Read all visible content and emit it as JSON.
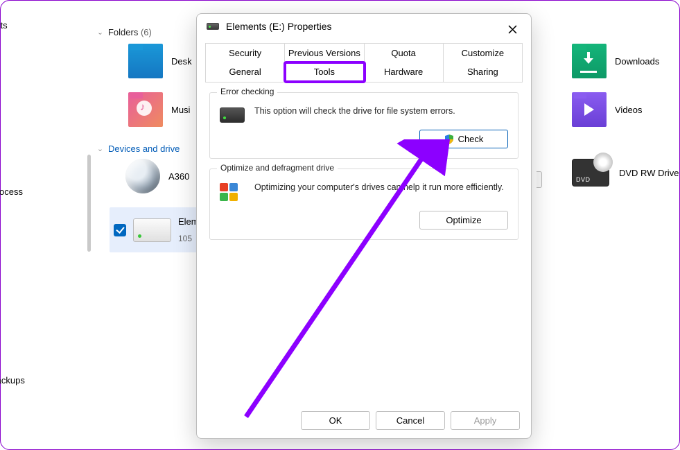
{
  "sidebar": {
    "cut1": "ents",
    "cut2": "Process",
    "cut3": "Backups"
  },
  "explorer": {
    "folders_header": "Folders",
    "folders_count": "(6)",
    "desktop": "Desk",
    "music": "Musi",
    "downloads": "Downloads",
    "videos": "Videos",
    "devices_header": "Devices and drive",
    "a360": "A360",
    "elements_name": "Elem",
    "elements_size": "105",
    "dvd": "DVD RW Drive"
  },
  "dialog": {
    "title": "Elements (E:) Properties",
    "tabs": {
      "security": "Security",
      "previous": "Previous Versions",
      "quota": "Quota",
      "customize": "Customize",
      "general": "General",
      "tools": "Tools",
      "hardware": "Hardware",
      "sharing": "Sharing"
    },
    "error_checking": {
      "legend": "Error checking",
      "text": "This option will check the drive for file system errors.",
      "button": "Check"
    },
    "optimize": {
      "legend": "Optimize and defragment drive",
      "text": "Optimizing your computer's drives can help it run more efficiently.",
      "button": "Optimize"
    },
    "footer": {
      "ok": "OK",
      "cancel": "Cancel",
      "apply": "Apply"
    }
  }
}
